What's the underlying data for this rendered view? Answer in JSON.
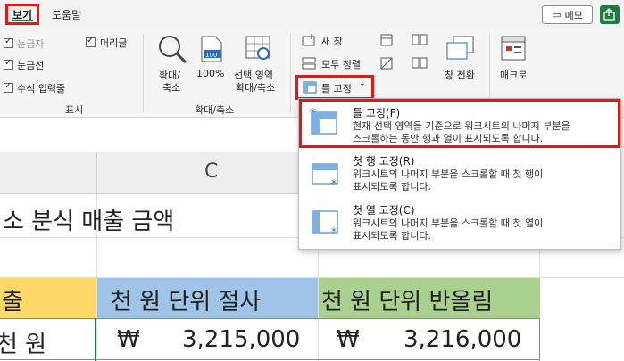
{
  "tabs": {
    "view": "보기",
    "help": "도움말"
  },
  "header_buttons": {
    "memo": "메모"
  },
  "ribbon": {
    "show_group": {
      "ruler": "눈금자",
      "formula_bar_top": "머리글",
      "gridlines": "눈금선",
      "formula_bar": "수식 입력줄",
      "label": "표시"
    },
    "zoom_group": {
      "zoom": "확대/\n축소",
      "zoom_l1": "확대/",
      "zoom_l2": "축소",
      "hundred": "100%",
      "selection_l1": "선택 영역",
      "selection_l2": "확대/축소",
      "label": "확대/축소"
    },
    "window_group": {
      "new_window": "새 창",
      "arrange_all": "모두 정렬",
      "freeze_panes": "틀 고정",
      "switch_windows": "창 전환"
    },
    "macro_group": {
      "macros": "매크로"
    }
  },
  "sheet": {
    "column_c": "C",
    "title_text": "소 분식 매출 금액",
    "header_left": "출",
    "header_blue": "천 원 단위 절사",
    "header_green": "천 원 단위 반올림",
    "row_left": "천 원",
    "currency": "₩",
    "value_blue": "3,215,000",
    "value_green": "3,216,000"
  },
  "menu": {
    "items": [
      {
        "title": "틀 고정(F)",
        "desc_l1": "현재 선택 영역을 기준으로 워크시트의 나머지 부분을",
        "desc_l2": "스크롤하는 동안 행과 열이 표시되도록 합니다."
      },
      {
        "title": "첫 행 고정(R)",
        "desc_l1": "워크시트의 나머지 부분을 스크롤할 때 첫 행이",
        "desc_l2": "표시되도록 합니다."
      },
      {
        "title": "첫 열 고정(C)",
        "desc_l1": "워크시트의 나머지 부분을 스크롤할 때 첫 열이",
        "desc_l2": "표시되도록 합니다."
      }
    ]
  },
  "colors": {
    "highlight": "#e01818",
    "accent": "#1f7a3e",
    "yellow": "#ffd967",
    "blue": "#9fc4e8",
    "green": "#a9d08e"
  }
}
